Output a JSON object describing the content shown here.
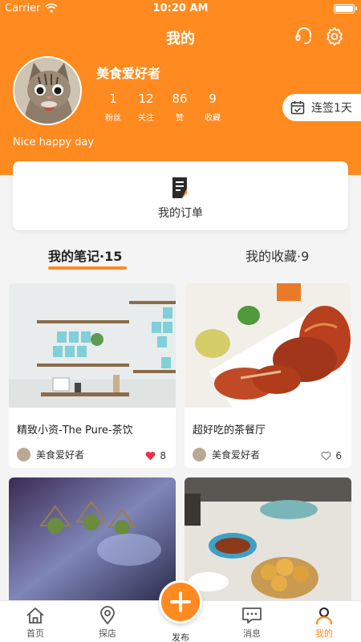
{
  "status_bar": {
    "carrier": "Carrier",
    "time": "10:20 AM"
  },
  "header": {
    "title": "我的",
    "username": "美食爱好者",
    "bio": "Nice happy day",
    "stats": [
      {
        "value": "1",
        "label": "粉丝"
      },
      {
        "value": "12",
        "label": "关注"
      },
      {
        "value": "86",
        "label": "赞"
      },
      {
        "value": "9",
        "label": "收藏"
      }
    ],
    "signin_label": "连签1天"
  },
  "orders": {
    "label": "我的订单"
  },
  "content_tabs": {
    "notes": "我的笔记·15",
    "favorites": "我的收藏·9"
  },
  "notes": [
    {
      "title": "精致小资-The Pure-茶饮",
      "author": "美食爱好者",
      "likes": "8",
      "liked": true
    },
    {
      "title": "超好吃的茶餐厅",
      "author": "美食爱好者",
      "likes": "6",
      "liked": false
    },
    {
      "title": "",
      "author": "",
      "likes": "",
      "liked": false
    },
    {
      "title": "",
      "author": "",
      "likes": "",
      "liked": false
    }
  ],
  "tabbar": {
    "home": "首页",
    "explore": "探店",
    "publish": "发布",
    "messages": "消息",
    "mine": "我的"
  },
  "colors": {
    "accent": "#ff8a1f",
    "like": "#e8334a"
  },
  "icons": [
    "wifi-icon",
    "battery-icon",
    "customer-service-icon",
    "settings-icon",
    "calendar-check-icon",
    "order-document-icon",
    "heart-icon",
    "home-icon",
    "location-pin-icon",
    "plus-icon",
    "message-icon",
    "user-icon"
  ]
}
